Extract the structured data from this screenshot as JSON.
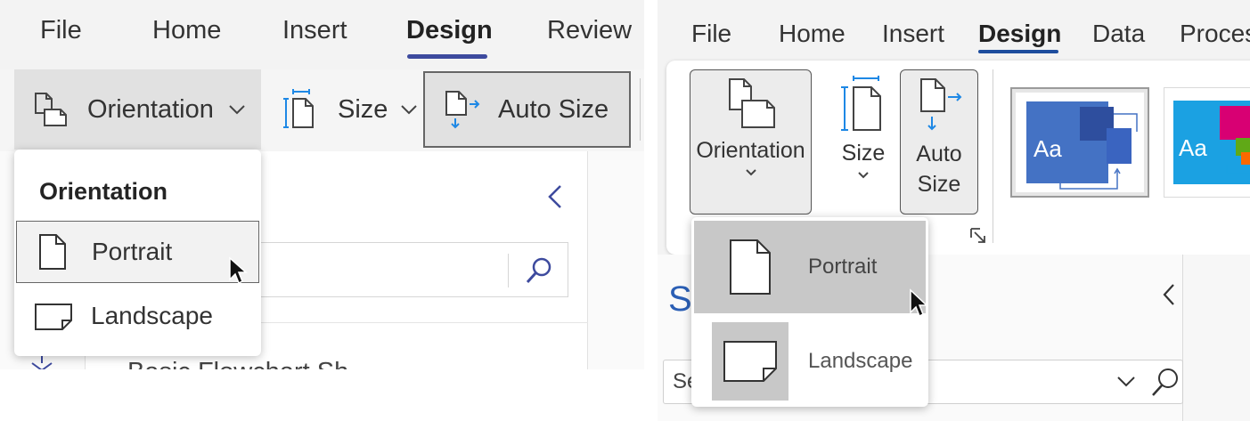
{
  "left_panel": {
    "tabs": [
      {
        "label": "File"
      },
      {
        "label": "Home"
      },
      {
        "label": "Insert"
      },
      {
        "label": "Design"
      },
      {
        "label": "Review"
      }
    ],
    "active_tab": "Design",
    "ribbon": {
      "orientation_label": "Orientation",
      "size_label": "Size",
      "auto_size_label": "Auto Size"
    },
    "dropdown": {
      "title": "Orientation",
      "items": [
        {
          "label": "Portrait",
          "state": "hovered"
        },
        {
          "label": "Landscape"
        }
      ]
    },
    "pane": {
      "stencil_label": "Basic Flowchart Sh"
    }
  },
  "right_panel": {
    "tabs": [
      {
        "label": "File"
      },
      {
        "label": "Home"
      },
      {
        "label": "Insert"
      },
      {
        "label": "Design"
      },
      {
        "label": "Data"
      },
      {
        "label": "Proces"
      }
    ],
    "active_tab": "Design",
    "ribbon": {
      "orientation_label": "Orientation",
      "size_label": "Size",
      "auto_label_line1": "Auto",
      "auto_label_line2": "Size",
      "themes": [
        {
          "label": "Aa",
          "color": "#4472c4"
        },
        {
          "label": "Aa",
          "color": "#1ba1e2"
        }
      ]
    },
    "dropdown": {
      "items": [
        {
          "label": "Portrait",
          "state": "hovered"
        },
        {
          "label": "Landscape"
        }
      ]
    },
    "pane": {
      "title": "S",
      "search_text": "Se"
    }
  },
  "colors": {
    "accent_left": "#3d4a9e",
    "accent_right": "#1f4e9e",
    "icon_blue": "#1e88e5",
    "hover_gray": "#c8c8c8"
  }
}
